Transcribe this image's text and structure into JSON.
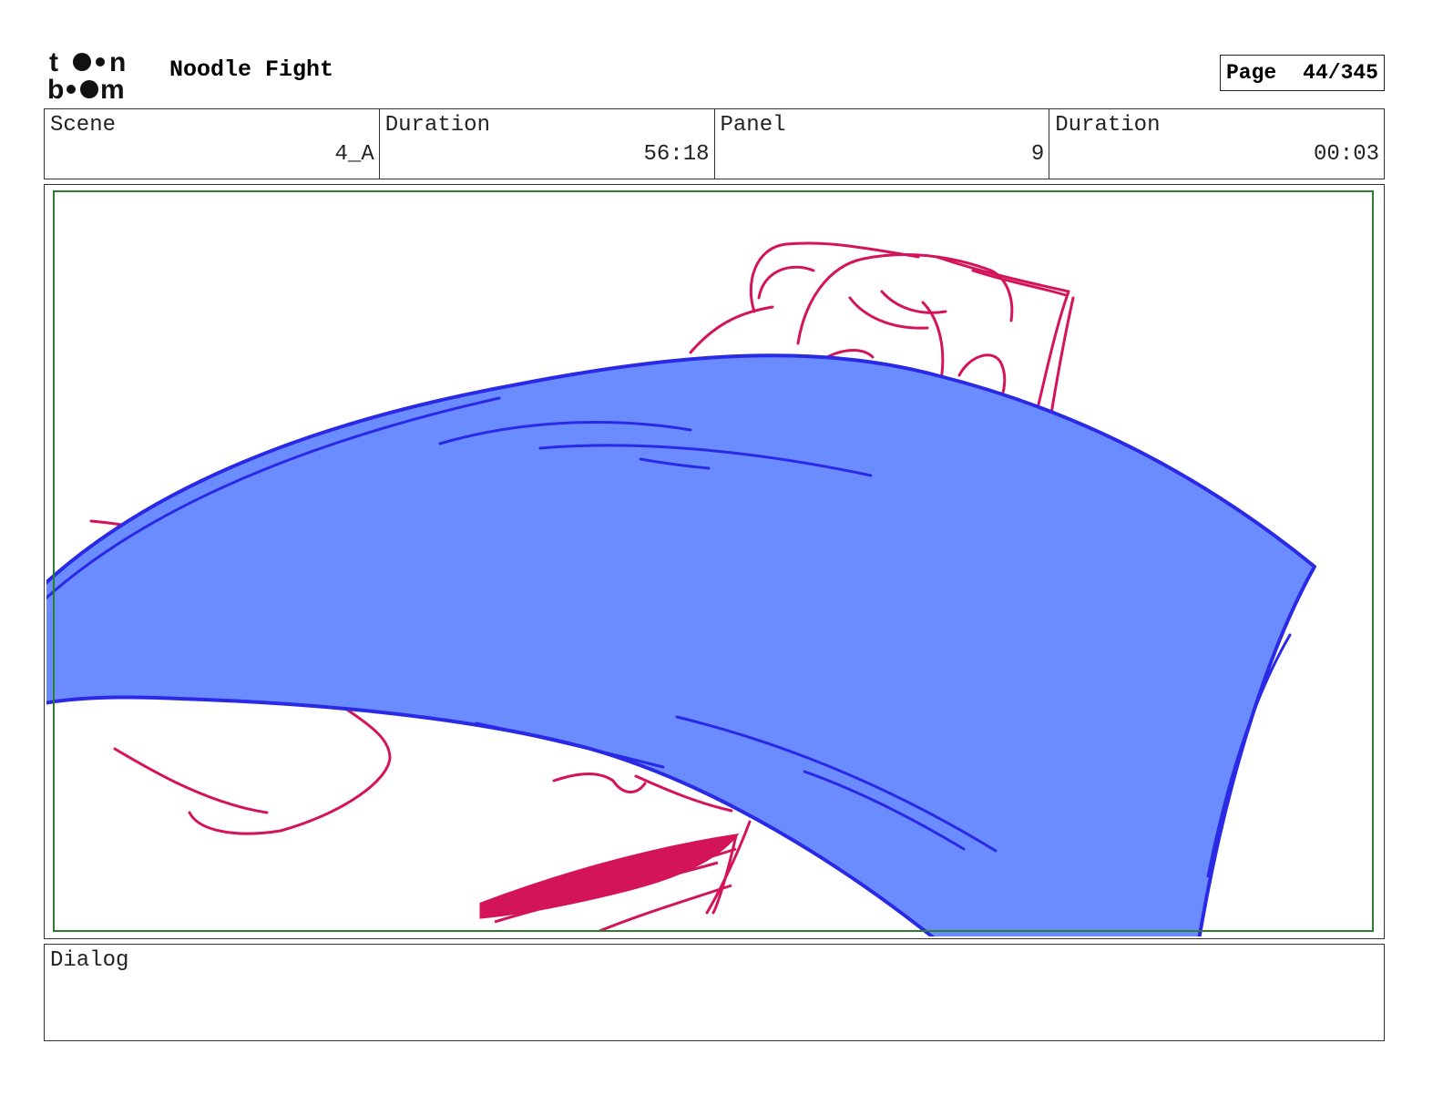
{
  "header": {
    "logo_text_top": "toon",
    "logo_text_bottom": "boom",
    "project_title": "Noodle Fight",
    "page_label": "Page",
    "page_value": "44/345"
  },
  "info": {
    "scene_label": "Scene",
    "scene_value": "4_A",
    "scene_duration_label": "Duration",
    "scene_duration_value": "56:18",
    "panel_label": "Panel",
    "panel_value": "9",
    "panel_duration_label": "Duration",
    "panel_duration_value": "00:03"
  },
  "dialog": {
    "label": "Dialog",
    "text": ""
  },
  "colors": {
    "noodle_fill": "#6b8cff",
    "noodle_stroke": "#2a2ae6",
    "sketch": "#d4145a",
    "safe_frame": "#2e7d32"
  }
}
